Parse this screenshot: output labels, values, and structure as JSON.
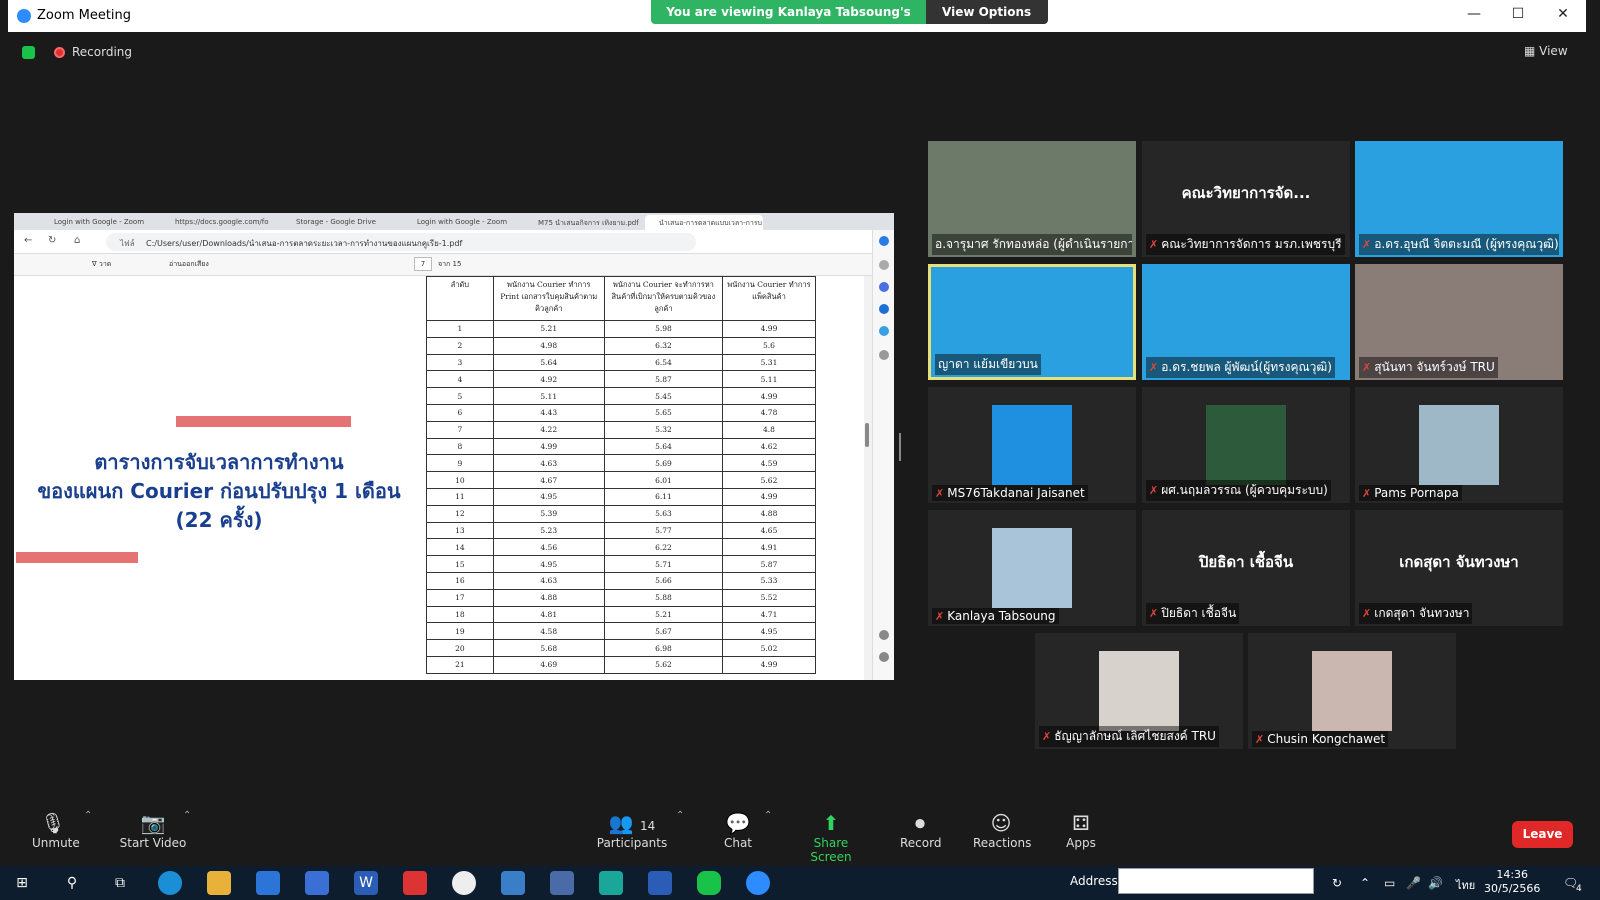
{
  "window": {
    "title": "Zoom Meeting"
  },
  "banner": {
    "viewing": "You are viewing Kanlaya Tabsoung's screen",
    "view_options": "View Options"
  },
  "status": {
    "recording": "Recording",
    "view": "View"
  },
  "browser": {
    "tabs": [
      "Login with Google - Zoom",
      "https://docs.google.com/fo",
      "Storage - Google Drive",
      "Login with Google - Zoom",
      "M75 นำเสนอกิจการ เทิงยาม.pdf",
      "นำเสนอ-การตลาดแบบเวลา-การบ"
    ],
    "url": "C:/Users/user/Downloads/นำเสนอ-การตลาดระยะเวลา-การทำงานของแผนกคูเรีย-1.pdf",
    "url_prefix": "ไฟล์",
    "pdf_toolbar": {
      "draw": "วาด",
      "read_aloud": "อ่านออกเสียง",
      "page": "7",
      "of_pages": "จาก 15"
    }
  },
  "slide": {
    "title_line1": "ตารางการจับเวลาการทำงาน",
    "title_line2": "ของแผนก Courier ก่อนปรับปรุง 1 เดือน",
    "title_line3": "(22 ครั้ง)"
  },
  "table": {
    "headers": [
      "ลำดับ",
      "พนักงาน Courier ทำการ Print เอกสารใบคุมสินค้าตามคิวลูกค้า",
      "พนักงาน Courier จะทำการหาสินค้าที่เบิกมาให้ครบตามคิวของลูกค้า",
      "พนักงาน Courier ทำการแพ็คสินค้า"
    ],
    "rows": [
      [
        "1",
        "5.21",
        "5.98",
        "4.99"
      ],
      [
        "2",
        "4.98",
        "6.32",
        "5.6"
      ],
      [
        "3",
        "5.64",
        "6.54",
        "5.31"
      ],
      [
        "4",
        "4.92",
        "5.87",
        "5.11"
      ],
      [
        "5",
        "5.11",
        "5.45",
        "4.99"
      ],
      [
        "6",
        "4.43",
        "5.65",
        "4.78"
      ],
      [
        "7",
        "4.22",
        "5.32",
        "4.8"
      ],
      [
        "8",
        "4.99",
        "5.64",
        "4.62"
      ],
      [
        "9",
        "4.63",
        "5.69",
        "4.59"
      ],
      [
        "10",
        "4.67",
        "6.01",
        "5.62"
      ],
      [
        "11",
        "4.95",
        "6.11",
        "4.99"
      ],
      [
        "12",
        "5.39",
        "5.63",
        "4.88"
      ],
      [
        "13",
        "5.23",
        "5.77",
        "4.65"
      ],
      [
        "14",
        "4.56",
        "6.22",
        "4.91"
      ],
      [
        "15",
        "4.95",
        "5.71",
        "5.87"
      ],
      [
        "16",
        "4.63",
        "5.66",
        "5.33"
      ],
      [
        "17",
        "4.88",
        "5.88",
        "5.52"
      ],
      [
        "18",
        "4.81",
        "5.21",
        "4.71"
      ],
      [
        "19",
        "4.58",
        "5.67",
        "4.95"
      ],
      [
        "20",
        "5.68",
        "6.98",
        "5.02"
      ],
      [
        "21",
        "4.69",
        "5.62",
        "4.99"
      ]
    ]
  },
  "participants": [
    {
      "name": "อ.จารุมาศ รักทองหล่อ (ผู้ดำเนินรายการ)",
      "muted": false,
      "video": true,
      "bg": "#6d7a6a"
    },
    {
      "name": "คณะวิทยาการจัดการ มรภ.เพชรบุรี",
      "muted": true,
      "video": false,
      "display": "คณะวิทยาการจัด..."
    },
    {
      "name": "อ.ดร.อุษณี จิตตะมณี (ผู้ทรงคุณวุฒิ)",
      "muted": true,
      "video": true,
      "bg": "#2aa0e0"
    },
    {
      "name": "ญาดา แย้มเขียวบน",
      "muted": false,
      "video": true,
      "active": true,
      "bg": "#2aa0e0"
    },
    {
      "name": "อ.ดร.ชยพล ผู้พัฒน์(ผู้ทรงคุณวุฒิ)",
      "muted": true,
      "video": true,
      "bg": "#2aa0e0"
    },
    {
      "name": "สุนันทา จันทร์วงษ์ TRU",
      "muted": true,
      "video": true,
      "bg": "#8a7d78"
    },
    {
      "name": "MS76Takdanai Jaisanet",
      "muted": true,
      "video": true,
      "bg": "#1f8fe0",
      "small": true
    },
    {
      "name": "ผศ.นฤมลวรรณ (ผู้ควบคุมระบบ)",
      "muted": true,
      "video": true,
      "bg": "#2d5a3a",
      "small": true
    },
    {
      "name": "Pams Pornapa",
      "muted": true,
      "video": true,
      "bg": "#9fb8c8",
      "small": true
    },
    {
      "name": "Kanlaya Tabsoung",
      "muted": true,
      "video": true,
      "bg": "#a9c4d8",
      "small": true
    },
    {
      "name": "ปิยธิดา เชื้อจีน",
      "muted": true,
      "video": false,
      "display": "ปิยธิดา เชื้อจีน"
    },
    {
      "name": "เกดสุดา จันทวงษา",
      "muted": true,
      "video": false,
      "display": "เกดสุดา จันทวงษา"
    },
    {
      "name": "ธัญญาลักษณ์ เลิศไชยสงค์ TRU",
      "muted": true,
      "video": true,
      "bg": "#d7d2cc",
      "small": true
    },
    {
      "name": "Chusin Kongchawet",
      "muted": true,
      "video": true,
      "bg": "#c9b7b0",
      "small": true
    }
  ],
  "toolbar": {
    "unmute": "Unmute",
    "start_video": "Start Video",
    "participants": "Participants",
    "participants_count": "14",
    "chat": "Chat",
    "share_screen": "Share Screen",
    "record": "Record",
    "reactions": "Reactions",
    "apps": "Apps",
    "leave": "Leave"
  },
  "taskbar": {
    "address_label": "Address",
    "time": "14:36",
    "date": "30/5/2566",
    "lang": "ไทย",
    "notif_count": "4"
  }
}
